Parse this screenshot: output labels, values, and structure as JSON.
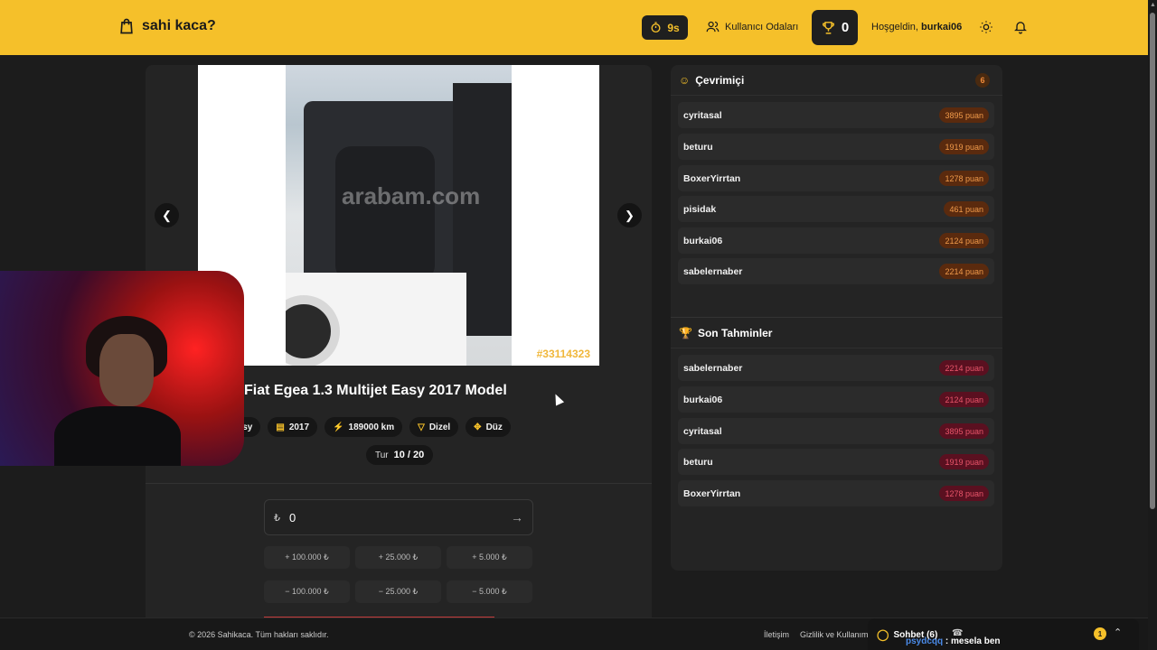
{
  "header": {
    "brand": "sahi kaca?",
    "timer": "9s",
    "rooms_label": "Kullanıcı Odaları",
    "trophy_count": "0",
    "welcome_prefix": "Hoşgeldin,",
    "username": "burkai06"
  },
  "car": {
    "watermark": "arabam.com",
    "id": "#33114323",
    "title": "Fiat Egea 1.3 Multijet Easy 2017 Model",
    "chips": [
      "Easy",
      "2017",
      "189000 km",
      "Dizel",
      "Düz"
    ],
    "round_label": "Tur",
    "round_value": "10 / 20"
  },
  "guess": {
    "currency": "₺",
    "value": "0",
    "increase": [
      "+ 100.000 ₺",
      "+ 25.000 ₺",
      "+ 5.000 ₺"
    ],
    "decrease": [
      "− 100.000 ₺",
      "− 25.000 ₺",
      "− 5.000 ₺"
    ]
  },
  "online": {
    "title": "Çevrimiçi",
    "count": "6",
    "players": [
      {
        "name": "cyritasal",
        "points": "3895 puan"
      },
      {
        "name": "beturu",
        "points": "1919 puan"
      },
      {
        "name": "BoxerYirrtan",
        "points": "1278 puan"
      },
      {
        "name": "pisidak",
        "points": "461 puan"
      },
      {
        "name": "burkai06",
        "points": "2124 puan"
      },
      {
        "name": "sabelernaber",
        "points": "2214 puan"
      }
    ]
  },
  "recent": {
    "title": "Son Tahminler",
    "players": [
      {
        "name": "sabelernaber",
        "points": "2214 puan"
      },
      {
        "name": "burkai06",
        "points": "2124 puan"
      },
      {
        "name": "cyritasal",
        "points": "3895 puan"
      },
      {
        "name": "beturu",
        "points": "1919 puan"
      },
      {
        "name": "BoxerYirrtan",
        "points": "1278 puan"
      }
    ]
  },
  "footer": {
    "copyright": "© 2026 Sahikaca. Tüm hakları saklıdır.",
    "link_contact": "İletişim",
    "link_privacy": "Gizlilik ve Kullanım"
  },
  "chat": {
    "title": "Sohbet (6)",
    "unread": "1",
    "last_user": "psydcqq",
    "last_text": ": mesela ben"
  },
  "colors": {
    "accent": "#f5c02a",
    "background": "#1c1c1c",
    "card": "#242424"
  },
  "icons": [
    "bag-icon",
    "timer-icon",
    "users-icon",
    "trophy-icon",
    "sun-icon",
    "bell-icon",
    "chevron-left-icon",
    "chevron-right-icon",
    "arrow-right-icon",
    "chat-icon",
    "phone-icon",
    "chevron-up-icon"
  ]
}
